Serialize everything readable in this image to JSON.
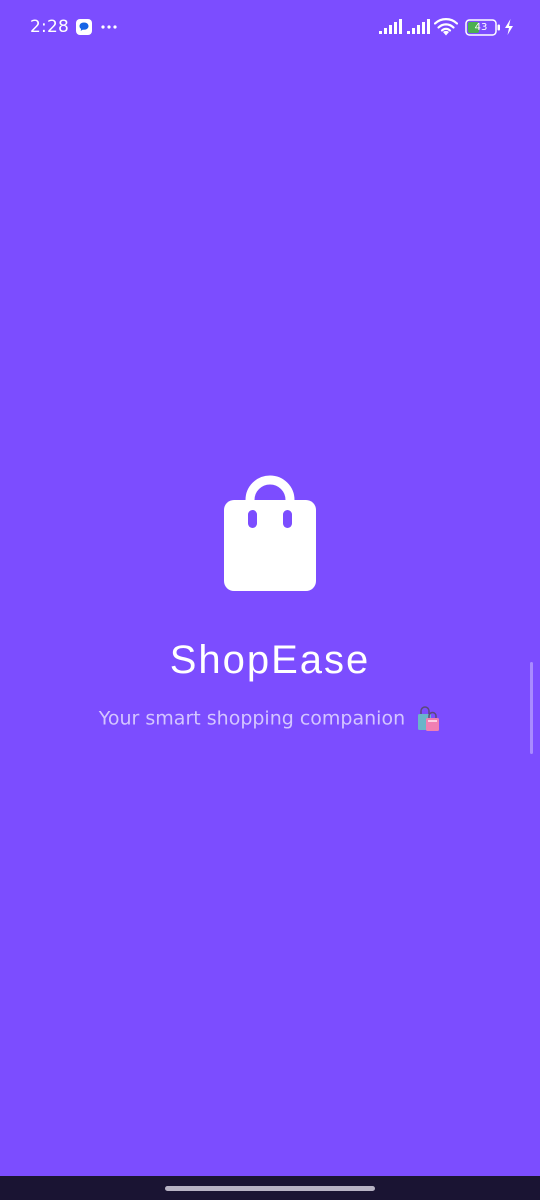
{
  "status_bar": {
    "time": "2:28",
    "battery_level": "43",
    "icons": [
      "chat-icon",
      "dots-icon",
      "signal-icon",
      "signal-icon",
      "wifi-icon",
      "battery-icon",
      "charging-icon"
    ]
  },
  "splash": {
    "app_name": "ShopEase",
    "tagline": "Your smart shopping companion",
    "logo_icon": "shopping-bag-icon",
    "tagline_emoji_icon": "shopping-bags-icon"
  },
  "colors": {
    "background": "#7c4dff",
    "text_primary": "#ffffff",
    "text_secondary": "#d4c6ff",
    "nav_bar": "#1a1433"
  }
}
